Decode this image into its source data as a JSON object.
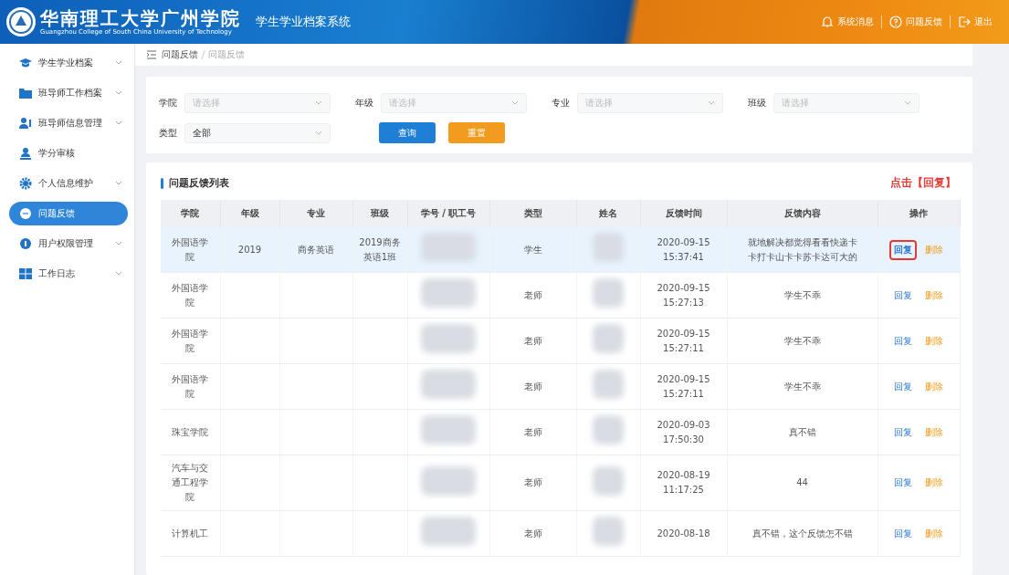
{
  "header": {
    "school_name": "华南理工大学广州学院",
    "school_name_en": "Guangzhou College of South China University of Technology",
    "system_title": "学生学业档案系统",
    "actions": [
      {
        "kind": "bell",
        "label": "系统消息"
      },
      {
        "kind": "question",
        "label": "问题反馈"
      },
      {
        "kind": "exit",
        "label": "退出"
      }
    ]
  },
  "sidebar": {
    "items": [
      {
        "label": "学生学业档案",
        "expandable": true,
        "selected": false
      },
      {
        "label": "班导师工作档案",
        "expandable": true,
        "selected": false
      },
      {
        "label": "班导师信息管理",
        "expandable": true,
        "selected": false
      },
      {
        "label": "学分审核",
        "expandable": false,
        "selected": false
      },
      {
        "label": "个人信息维护",
        "expandable": true,
        "selected": false
      },
      {
        "label": "问题反馈",
        "expandable": false,
        "selected": true
      },
      {
        "label": "用户权限管理",
        "expandable": true,
        "selected": false
      },
      {
        "label": "工作日志",
        "expandable": true,
        "selected": false
      }
    ]
  },
  "breadcrumb": [
    "问题反馈",
    "问题反馈"
  ],
  "filters": {
    "fields": [
      {
        "label": "学院",
        "placeholder": "请选择"
      },
      {
        "label": "年级",
        "placeholder": "请选择"
      },
      {
        "label": "专业",
        "placeholder": "请选择"
      },
      {
        "label": "班级",
        "placeholder": "请选择"
      },
      {
        "label": "类型",
        "value": "全部"
      }
    ],
    "buttons": [
      {
        "kind": "primary",
        "label": "查询"
      },
      {
        "kind": "warning",
        "label": "重置"
      }
    ]
  },
  "table": {
    "title": "问题反馈列表",
    "annotation": "点击【回复】",
    "columns": [
      "学院",
      "年级",
      "专业",
      "班级",
      "学号 / 职工号",
      "类型",
      "姓名",
      "反馈时间",
      "反馈内容",
      "操作"
    ],
    "rows": [
      {
        "selected": true,
        "college": "外国语学院",
        "grade": "2019",
        "major": "商务英语",
        "class": "2019商务英语1班",
        "id_redacted": true,
        "type": "学生",
        "name_redacted": true,
        "time": "2020-09-15 15:37:41",
        "content": "就地解决都觉得看看快递卡卡打卡山卡卡苏卡达可大的",
        "actions": [
          {
            "kind": "reply",
            "label": "回复",
            "annotated": true
          },
          {
            "kind": "delete",
            "label": "删除",
            "annotated": false
          }
        ]
      },
      {
        "selected": false,
        "college": "外国语学院",
        "type": "老师",
        "id_redacted": true,
        "name_redacted": true,
        "time": "2020-09-15 15:27:13",
        "content": "学生不乖",
        "actions": [
          {
            "kind": "reply",
            "label": "回复",
            "annotated": false
          },
          {
            "kind": "delete",
            "label": "删除",
            "annotated": false
          }
        ]
      },
      {
        "selected": false,
        "college": "外国语学院",
        "type": "老师",
        "id_redacted": true,
        "name_redacted": true,
        "time": "2020-09-15 15:27:11",
        "content": "学生不乖",
        "actions": [
          {
            "kind": "reply",
            "label": "回复",
            "annotated": false
          },
          {
            "kind": "delete",
            "label": "删除",
            "annotated": false
          }
        ]
      },
      {
        "selected": false,
        "college": "外国语学院",
        "type": "老师",
        "id_redacted": true,
        "name_redacted": true,
        "time": "2020-09-15 15:27:11",
        "content": "学生不乖",
        "actions": [
          {
            "kind": "reply",
            "label": "回复",
            "annotated": false
          },
          {
            "kind": "delete",
            "label": "删除",
            "annotated": false
          }
        ]
      },
      {
        "selected": false,
        "college": "珠宝学院",
        "type": "老师",
        "id_redacted": true,
        "name_redacted": true,
        "time": "2020-09-03 17:50:30",
        "content": "真不错",
        "actions": [
          {
            "kind": "reply",
            "label": "回复",
            "annotated": false
          },
          {
            "kind": "delete",
            "label": "删除",
            "annotated": false
          }
        ]
      },
      {
        "selected": false,
        "college": "汽车与交通工程学院",
        "type": "老师",
        "id_redacted": true,
        "name_redacted": true,
        "time": "2020-08-19 11:17:25",
        "content": "44",
        "actions": [
          {
            "kind": "reply",
            "label": "回复",
            "annotated": false
          },
          {
            "kind": "delete",
            "label": "删除",
            "annotated": false
          }
        ]
      },
      {
        "selected": false,
        "college": "计算机工",
        "type": "老师",
        "id_redacted": true,
        "name_redacted": true,
        "time": "2020-08-18",
        "content": "真不错，这个反馈怎不错",
        "actions": [
          {
            "kind": "reply",
            "label": "回复",
            "annotated": false
          },
          {
            "kind": "delete",
            "label": "删除",
            "annotated": false
          }
        ]
      }
    ]
  }
}
